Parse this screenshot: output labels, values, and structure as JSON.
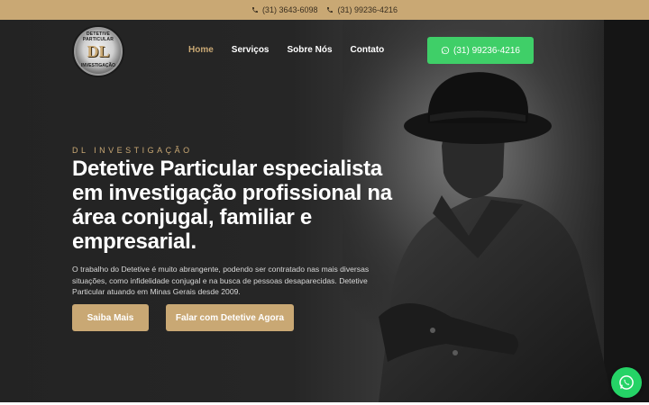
{
  "topbar": {
    "phone_1": "(31) 3643-6098",
    "phone_2": "(31) 99236-4216",
    "phone_icon": "phone-icon"
  },
  "logo": {
    "ring_top": "DETETIVE PARTICULAR",
    "monogram": "DL",
    "ring_bottom": "INVESTIGAÇÃO"
  },
  "nav": {
    "items": [
      "Home",
      "Serviços",
      "Sobre Nós",
      "Contato"
    ],
    "active": "Home"
  },
  "header_cta": {
    "label": "(31) 99236-4216",
    "icon": "whatsapp-icon"
  },
  "hero": {
    "eyebrow": "DL INVESTIGAÇÃO",
    "headline": "Detetive Particular especialista em investigação profissional na área conjugal, familiar e empresarial.",
    "description": "O trabalho do Detetive é muito abrangente, podendo ser contratado nas mais diversas situações, como infidelidade conjugal e na busca de pessoas desaparecidas. Detetive Particular atuando em Minas Gerais desde 2009.",
    "button_primary": "Saiba Mais",
    "button_secondary": "Falar com Detetive Agora"
  },
  "floating": {
    "icon": "whatsapp-icon"
  },
  "colors": {
    "accent": "#c9a874",
    "whatsapp": "#3fcf68",
    "background": "#232323",
    "text": "#ffffff"
  }
}
